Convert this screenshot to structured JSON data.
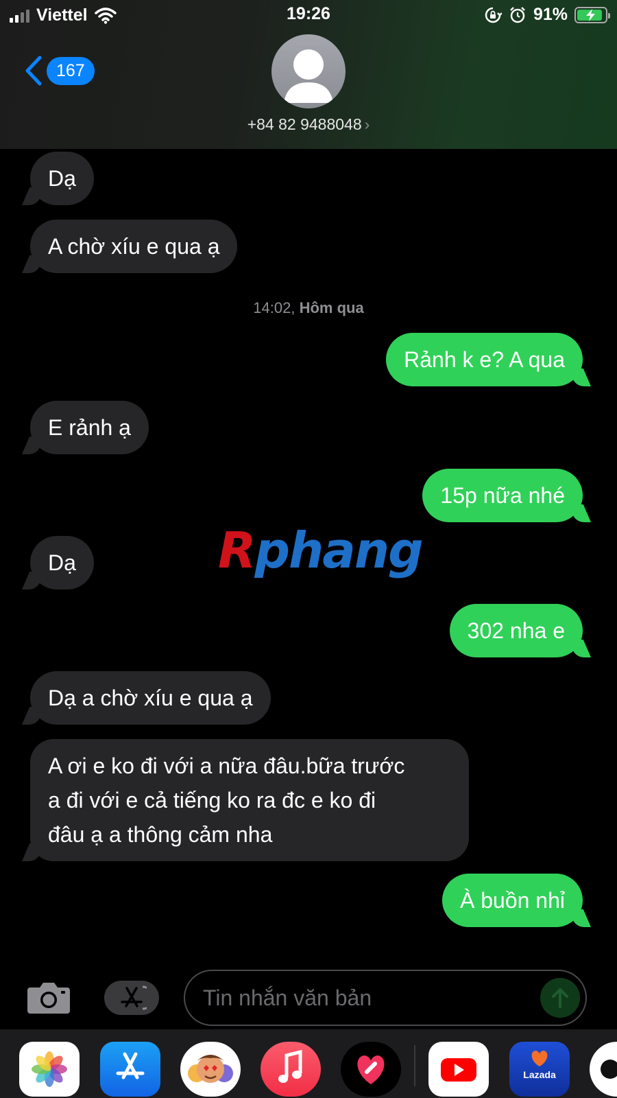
{
  "status_bar": {
    "carrier": "Viettel",
    "time": "19:26",
    "battery_percent": "91%"
  },
  "header": {
    "back_badge": "167",
    "contact_number": "+84 82 9488048",
    "contact_chevron": "›"
  },
  "messages": [
    {
      "side": "in",
      "text": "Dạ"
    },
    {
      "side": "in",
      "text": "A chờ xíu e qua ạ"
    },
    {
      "side": "stamp",
      "time": "14:02,",
      "day": "Hôm qua"
    },
    {
      "side": "out",
      "text": "Rảnh k e? A qua"
    },
    {
      "side": "in",
      "text": "E rảnh ạ"
    },
    {
      "side": "out",
      "text": "15p nữa nhé"
    },
    {
      "side": "in",
      "text": "Dạ"
    },
    {
      "side": "out",
      "text": "302 nha e"
    },
    {
      "side": "in",
      "text": "Dạ a chờ xíu e qua ạ"
    },
    {
      "side": "in",
      "lines": [
        "A ơi e ko đi với a nữa đâu.bữa trước",
        "a  đi với e cả tiếng ko ra đc e ko đi",
        "đâu ạ a thông cảm nha"
      ]
    },
    {
      "side": "out",
      "text": "À buồn nhỉ"
    }
  ],
  "watermark": {
    "part1": "R",
    "part2": "phang"
  },
  "composer": {
    "placeholder": "Tin nhắn văn bản"
  },
  "app_drawer": {
    "apps": [
      "photos-icon",
      "app-store-icon",
      "memoji-icon",
      "music-icon",
      "heart-sticker-icon",
      "youtube-icon",
      "lazada-icon",
      "more-app-icon"
    ],
    "lazada_label": "Lazada"
  },
  "colors": {
    "outgoing_bubble": "#30d158",
    "incoming_bubble": "#262628",
    "badge": "#0a84ff"
  }
}
